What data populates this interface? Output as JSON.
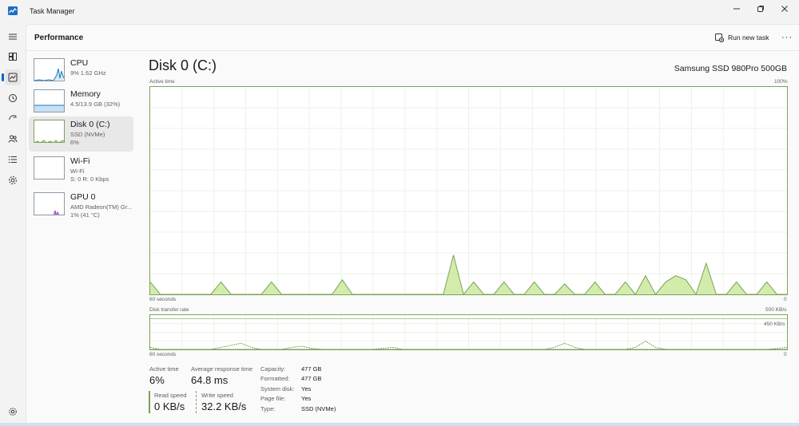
{
  "window": {
    "title": "Task Manager"
  },
  "colors": {
    "accent": "#0067c0",
    "disk_line": "#79a35a",
    "disk_fill": "#d3ecab",
    "cpu_line": "#1a7bbf",
    "gpu_line": "#8b3bc7"
  },
  "nav": {
    "items": [
      "hamburger-icon",
      "processes-icon",
      "performance-icon",
      "app-history-icon",
      "startup-icon",
      "users-icon",
      "details-icon",
      "services-icon"
    ],
    "settings": "settings-icon",
    "active": "performance-icon"
  },
  "header": {
    "title": "Performance",
    "run_task_label": "Run new task",
    "more_label": "···"
  },
  "devices": [
    {
      "name": "CPU",
      "line1": "9%  1.62 GHz",
      "line2": ""
    },
    {
      "name": "Memory",
      "line1": "4.5/13.9 GB (32%)",
      "line2": ""
    },
    {
      "name": "Disk 0 (C:)",
      "line1": "SSD (NVMe)",
      "line2": "6%"
    },
    {
      "name": "Wi-Fi",
      "line1": "Wi-Fi",
      "line2": "S: 0  R: 0 Kbps"
    },
    {
      "name": "GPU 0",
      "line1": "AMD Radeon(TM) Gr...",
      "line2": "1%  (41 °C)"
    }
  ],
  "detail": {
    "title": "Disk 0 (C:)",
    "model": "Samsung SSD 980Pro 500GB",
    "active_graph": {
      "label": "Active time",
      "max": "100%",
      "time": "60 seconds",
      "min": "0"
    },
    "transfer_graph": {
      "label": "Disk transfer rate",
      "max": "500 KB/s",
      "time": "60 seconds",
      "min": "0",
      "marker": "450 KB/s"
    },
    "stats": {
      "active_time_label": "Active time",
      "active_time": "6%",
      "response_label": "Average response time",
      "response": "64.8 ms",
      "read_label": "Read speed",
      "read": "0 KB/s",
      "write_label": "Write speed",
      "write": "32.2 KB/s"
    },
    "properties": [
      {
        "key": "Capacity:",
        "value": "477 GB"
      },
      {
        "key": "Formatted:",
        "value": "477 GB"
      },
      {
        "key": "System disk:",
        "value": "Yes"
      },
      {
        "key": "Page file:",
        "value": "Yes"
      },
      {
        "key": "Type:",
        "value": "SSD (NVMe)"
      }
    ]
  },
  "chart_data": [
    {
      "type": "area",
      "xlabel": "60 seconds",
      "ylim": [
        0,
        100
      ],
      "ylabel": "Active time",
      "series": [
        {
          "values": [
            6,
            0,
            0,
            0,
            0,
            0,
            0,
            6,
            0,
            0,
            0,
            0,
            6,
            0,
            0,
            0,
            0,
            0,
            0,
            7,
            0,
            0,
            0,
            0,
            0,
            0,
            0,
            0,
            0,
            0,
            19,
            0,
            6,
            0,
            0,
            6,
            0,
            0,
            6,
            0,
            0,
            5,
            0,
            0,
            6,
            0,
            0,
            6,
            0,
            9,
            0,
            6,
            9,
            7,
            0,
            15,
            0,
            0,
            6,
            0,
            0,
            6,
            0,
            0
          ]
        }
      ]
    },
    {
      "type": "line",
      "xlabel": "60 seconds",
      "ylim": [
        0,
        500
      ],
      "ylabel": "Disk transfer rate",
      "series": [
        {
          "values": [
            30,
            0,
            0,
            0,
            0,
            0,
            0,
            30,
            60,
            90,
            30,
            0,
            0,
            0,
            30,
            45,
            15,
            0,
            0,
            0,
            0,
            0,
            0,
            15,
            30,
            0,
            0,
            0,
            0,
            0,
            0,
            0,
            0,
            0,
            0,
            0,
            0,
            0,
            0,
            0,
            30,
            90,
            30,
            0,
            0,
            0,
            0,
            0,
            30,
            120,
            30,
            0,
            0,
            0,
            0,
            0,
            0,
            0,
            0,
            0,
            0,
            0,
            15,
            30
          ]
        },
        {
          "values": [
            0,
            0,
            0,
            0,
            0,
            0,
            0,
            0,
            0,
            0,
            0,
            0,
            0,
            0,
            0,
            0,
            0,
            0,
            0,
            0,
            0,
            0,
            0,
            0,
            0,
            0,
            0,
            0,
            0,
            0,
            0,
            0,
            0,
            0,
            0,
            0,
            0,
            0,
            0,
            0,
            0,
            0,
            0,
            0,
            0,
            0,
            0,
            0,
            0,
            0,
            0,
            0,
            0,
            0,
            0,
            0,
            0,
            0,
            0,
            0,
            0,
            0,
            0,
            0
          ]
        }
      ]
    }
  ]
}
